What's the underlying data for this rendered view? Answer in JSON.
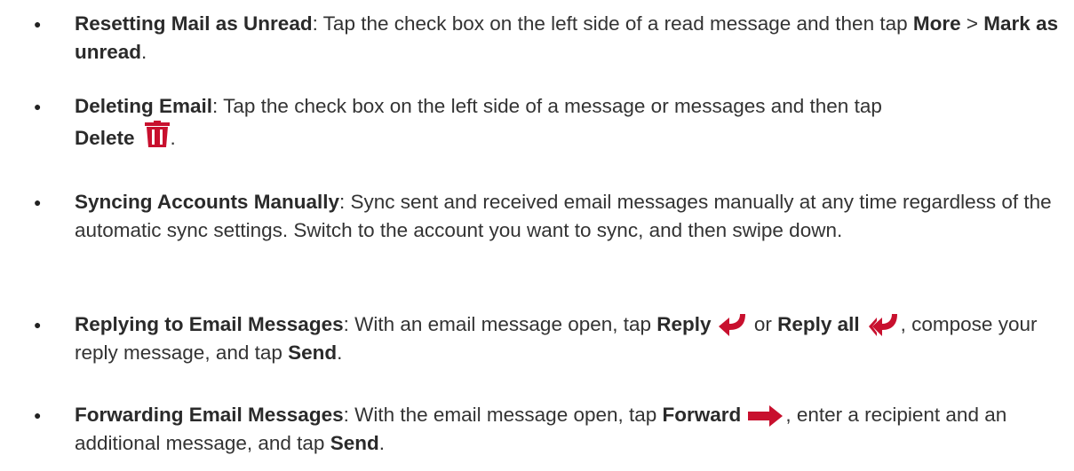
{
  "bullet_char": "●",
  "icon_color": "#c8102e",
  "items": [
    {
      "title": "Resetting Mail as Unread",
      "text1": ": Tap the check box on the left side of a read message and then tap ",
      "bold1": "More",
      "sep": " > ",
      "bold2": "Mark as unread",
      "end": "."
    },
    {
      "title": "Deleting Email",
      "text1": ": Tap the check box on the left side of a message or messages and then tap ",
      "bold1": "Delete",
      "icon": "trash-icon",
      "end": "."
    },
    {
      "title": "Syncing Accounts Manually",
      "text1": ": Sync sent and received email messages manually at any time regardless of the automatic sync settings. Switch to the account you want to sync, and then swipe down."
    },
    {
      "title": "Replying to Email Messages",
      "text1": ": With an email message open, tap ",
      "bold1": "Reply",
      "icon1": "reply-arrow-icon",
      "text2": " or ",
      "bold2": "Reply all",
      "icon2": "reply-all-arrow-icon",
      "text3": ", compose your reply message, and tap ",
      "bold3": "Send",
      "end": "."
    },
    {
      "title": "Forwarding Email Messages",
      "text1": ": With the email message open, tap ",
      "bold1": "Forward",
      "icon": "forward-arrow-icon",
      "text2": ", enter a recipient and an additional message, and tap ",
      "bold2": "Send",
      "end": "."
    }
  ]
}
